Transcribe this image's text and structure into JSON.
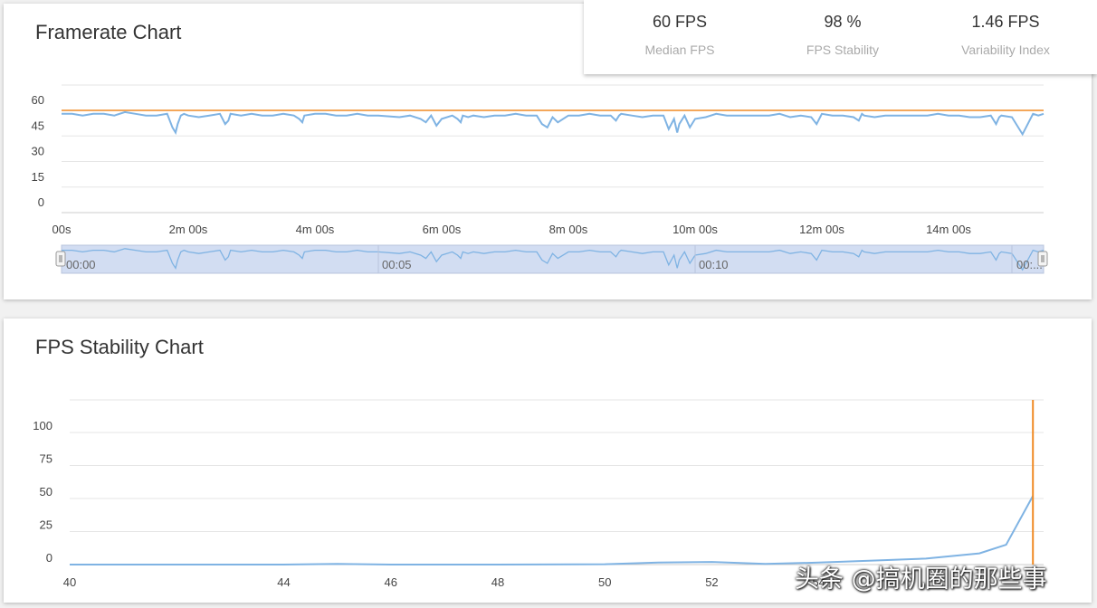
{
  "framerate_card": {
    "title": "Framerate Chart"
  },
  "stats": [
    {
      "value": "60 FPS",
      "label": "Median FPS"
    },
    {
      "value": "98 %",
      "label": "FPS Stability"
    },
    {
      "value": "1.46 FPS",
      "label": "Variability Index"
    }
  ],
  "stability_card": {
    "title": "FPS Stability Chart"
  },
  "slider": {
    "labels": [
      "00:00",
      "00:05",
      "00:10",
      "00:..."
    ]
  },
  "watermark": "头条 @搞机圈的那些事",
  "colors": {
    "fps_line": "#7fb3e3",
    "target_line": "#f08a24",
    "grid": "#e6e6e6",
    "slider_fill": "#d2ddf2"
  },
  "chart_data": [
    {
      "type": "line",
      "title": "Framerate Chart",
      "x_unit": "seconds",
      "xlim": [
        0,
        930
      ],
      "ylim": [
        0,
        60
      ],
      "y_ticks": [
        60,
        45,
        30,
        15,
        0
      ],
      "x_tick_values": [
        0,
        120,
        240,
        360,
        480,
        600,
        720,
        840
      ],
      "x_tick_labels": [
        "00s",
        "2m 00s",
        "4m 00s",
        "6m 00s",
        "8m 00s",
        "10m 00s",
        "12m 00s",
        "14m 00s"
      ],
      "grid": true,
      "series": [
        {
          "role": "target",
          "color": "#f08a24",
          "x": [
            0,
            930
          ],
          "values": [
            60,
            60
          ]
        },
        {
          "role": "fps",
          "color": "#7fb3e3",
          "x": [
            0,
            10,
            20,
            30,
            40,
            50,
            60,
            70,
            80,
            90,
            100,
            105,
            108,
            110,
            113,
            116,
            120,
            130,
            140,
            150,
            155,
            158,
            160,
            170,
            180,
            190,
            200,
            210,
            220,
            225,
            228,
            230,
            240,
            250,
            260,
            270,
            280,
            290,
            300,
            320,
            330,
            340,
            345,
            350,
            355,
            360,
            370,
            375,
            378,
            380,
            385,
            390,
            400,
            410,
            420,
            430,
            440,
            450,
            455,
            460,
            465,
            470,
            480,
            490,
            500,
            510,
            520,
            525,
            528,
            530,
            540,
            550,
            560,
            570,
            575,
            580,
            583,
            585,
            590,
            595,
            600,
            610,
            620,
            630,
            640,
            650,
            660,
            670,
            680,
            690,
            700,
            710,
            715,
            720,
            730,
            740,
            750,
            755,
            758,
            760,
            770,
            780,
            790,
            800,
            810,
            820,
            830,
            840,
            850,
            860,
            870,
            880,
            885,
            888,
            890,
            900,
            910,
            920,
            925,
            930
          ],
          "values": [
            58,
            58,
            57,
            58,
            58,
            57,
            59,
            58,
            57,
            57,
            58,
            50,
            47,
            52,
            57,
            58,
            57,
            56,
            57,
            58,
            52,
            54,
            58,
            57,
            58,
            57,
            57,
            58,
            57,
            55,
            53,
            57,
            58,
            58,
            57,
            57,
            58,
            57,
            57,
            56,
            57,
            55,
            53,
            57,
            51,
            55,
            57,
            55,
            53,
            57,
            56,
            57,
            56,
            57,
            57,
            58,
            57,
            57,
            52,
            50,
            56,
            53,
            57,
            57,
            58,
            57,
            57,
            54,
            57,
            58,
            57,
            56,
            57,
            57,
            49,
            55,
            47,
            52,
            57,
            50,
            55,
            56,
            58,
            57,
            57,
            57,
            57,
            57,
            58,
            56,
            57,
            56,
            52,
            58,
            57,
            57,
            56,
            54,
            58,
            57,
            56,
            57,
            57,
            57,
            57,
            57,
            58,
            57,
            57,
            56,
            56,
            57,
            52,
            56,
            57,
            56,
            46,
            58,
            57,
            58
          ]
        }
      ]
    },
    {
      "type": "line",
      "title": "FPS Stability Chart",
      "xlim": [
        40,
        58.2
      ],
      "ylim": [
        0,
        100
      ],
      "y_ticks": [
        100,
        75,
        50,
        25,
        0
      ],
      "x_ticks": [
        40,
        44,
        46,
        48,
        50,
        52,
        54
      ],
      "grid": true,
      "series": [
        {
          "role": "distribution",
          "color": "#7fb3e3",
          "x": [
            40,
            44,
            45,
            46,
            48,
            50,
            51,
            52,
            53,
            54,
            55,
            56,
            57,
            57.5,
            58
          ],
          "values": [
            0,
            0,
            0.5,
            0,
            0,
            0.3,
            1.5,
            2,
            0.5,
            1.5,
            3,
            4.5,
            8.5,
            15,
            52
          ]
        },
        {
          "role": "target",
          "color": "#f08a24",
          "x": [
            58,
            58
          ],
          "values": [
            0,
            125
          ]
        }
      ]
    }
  ]
}
